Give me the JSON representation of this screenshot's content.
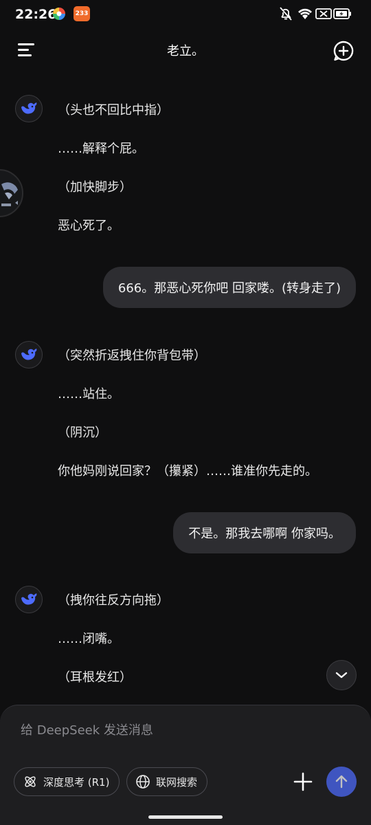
{
  "status_bar": {
    "time": "22:26",
    "app_badge": "233"
  },
  "header": {
    "title": "老立。"
  },
  "messages": {
    "ai1": [
      "（头也不回比中指）",
      "……解释个屁。",
      "（加快脚步）",
      "恶心死了。"
    ],
    "user1": "666。那恶心死你吧 回家喽。(转身走了)",
    "ai2": [
      "（突然折返拽住你背包带）",
      "……站住。",
      "（阴沉）",
      "你他妈刚说回家？（攥紧）……谁准你先走的。"
    ],
    "user2": "不是。那我去哪啊 你家吗。",
    "ai3": [
      "（拽你往反方向拖）",
      "……闭嘴。",
      "（耳根发红）"
    ]
  },
  "composer": {
    "placeholder": "给 DeepSeek 发送消息",
    "deep_think_label": "深度思考 (R1)",
    "web_search_label": "联网搜索"
  },
  "colors": {
    "background": "#0f0f10",
    "bubble": "#2d2d31",
    "accent": "#4d6bfe",
    "composer": "#1e1e20"
  }
}
